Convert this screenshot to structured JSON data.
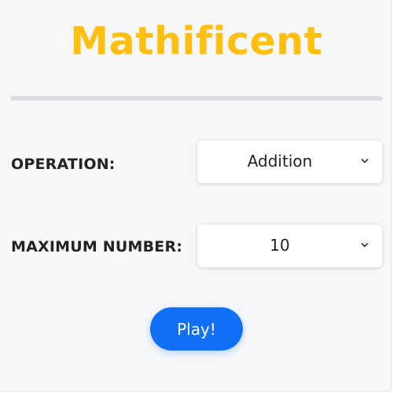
{
  "app": {
    "title": "Mathificent",
    "title_color": "#ffbf0f"
  },
  "form": {
    "operation": {
      "label": "OPERATION:",
      "selected": "Addition",
      "icon": "chevron-down-icon"
    },
    "max_number": {
      "label": "MAXIMUM NUMBER:",
      "selected": "10",
      "icon": "chevron-down-icon"
    }
  },
  "actions": {
    "play_label": "Play!",
    "play_color": "#1070f7"
  }
}
